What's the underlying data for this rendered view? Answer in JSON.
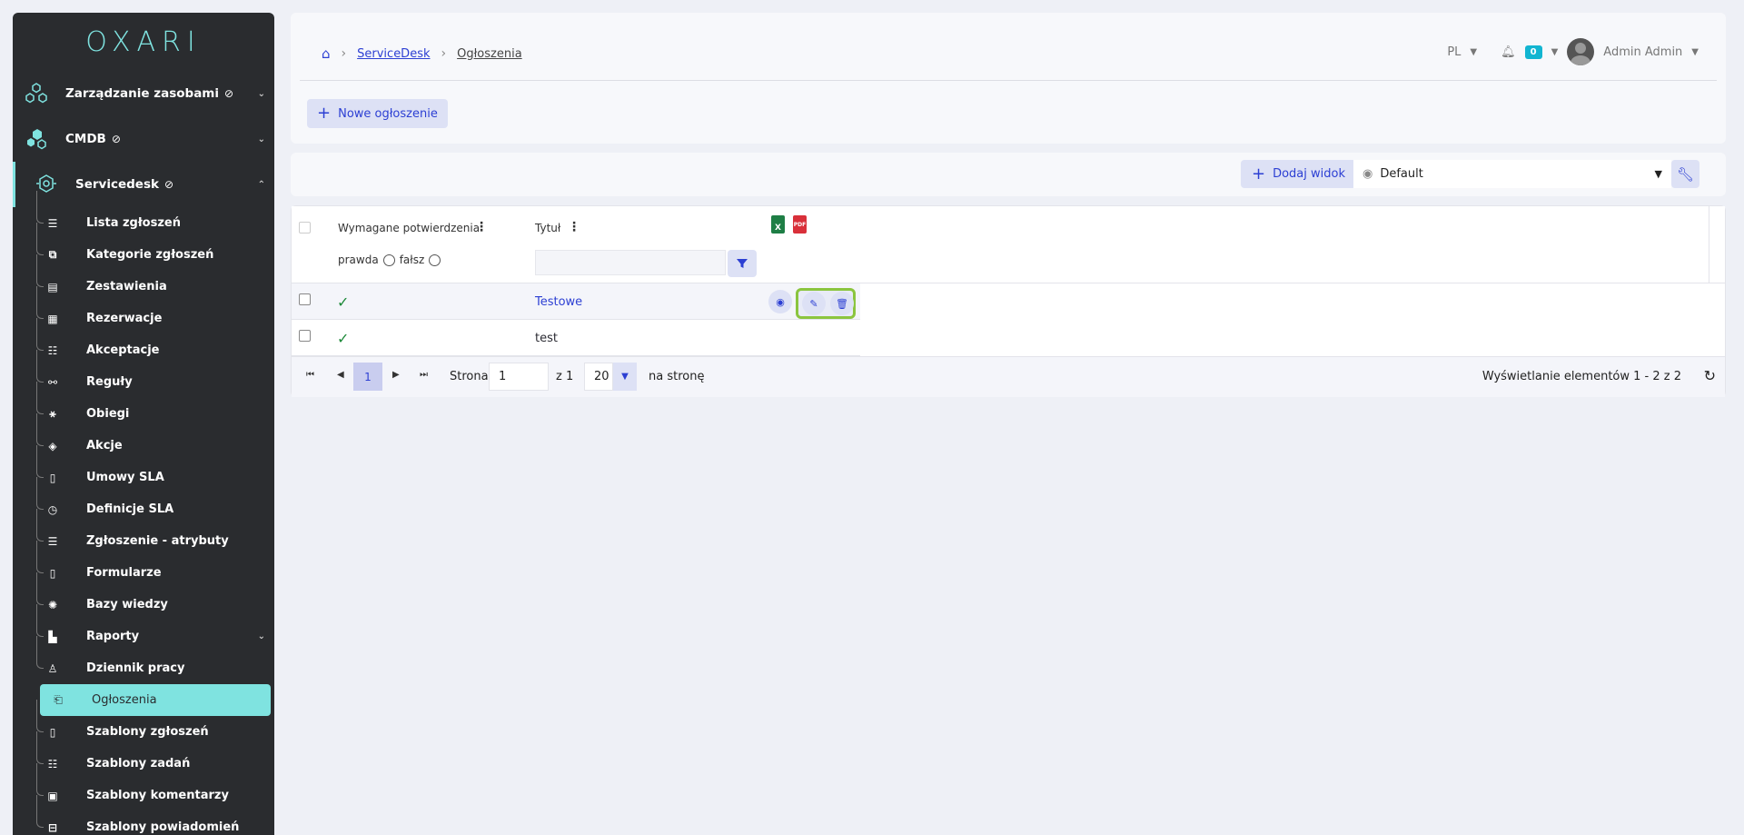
{
  "app": {
    "logo": "OXARI"
  },
  "sidebar": {
    "top_items": [
      {
        "label": "Zarządzanie zasobami",
        "badge": "⊘"
      },
      {
        "label": "CMDB",
        "badge": "⊘"
      },
      {
        "label": "Servicedesk",
        "badge": "⊘"
      }
    ],
    "sub_items": [
      {
        "label": "Lista zgłoszeń"
      },
      {
        "label": "Kategorie zgłoszeń"
      },
      {
        "label": "Zestawienia"
      },
      {
        "label": "Rezerwacje"
      },
      {
        "label": "Akceptacje"
      },
      {
        "label": "Reguły"
      },
      {
        "label": "Obiegi"
      },
      {
        "label": "Akcje"
      },
      {
        "label": "Umowy SLA"
      },
      {
        "label": "Definicje SLA"
      },
      {
        "label": "Zgłoszenie - atrybuty"
      },
      {
        "label": "Formularze"
      },
      {
        "label": "Bazy wiedzy"
      },
      {
        "label": "Raporty"
      },
      {
        "label": "Dziennik pracy"
      },
      {
        "label": "Ogłoszenia"
      },
      {
        "label": "Szablony zgłoszeń"
      },
      {
        "label": "Szablony zadań"
      },
      {
        "label": "Szablony komentarzy"
      },
      {
        "label": "Szablony powiadomień"
      }
    ]
  },
  "breadcrumb": {
    "items": [
      "ServiceDesk",
      "Ogłoszenia"
    ]
  },
  "header": {
    "lang": "PL",
    "notifications": "0",
    "user": "Admin Admin"
  },
  "toolbar": {
    "new_label": "Nowe ogłoszenie"
  },
  "view": {
    "add_label": "Dodaj widok",
    "selected": "Default"
  },
  "table": {
    "columns": [
      "Wymagane potwierdzenia",
      "Tytuł"
    ],
    "filter": {
      "true_label": "prawda",
      "false_label": "fałsz"
    },
    "export": {
      "xls": "X",
      "pdf": "PDF"
    },
    "rows": [
      {
        "confirm": "✓",
        "title": "Testowe"
      },
      {
        "confirm": "✓",
        "title": "test"
      }
    ]
  },
  "pager": {
    "current_page": "1",
    "page_label": "Strona",
    "page_value": "1",
    "of_label": "z 1",
    "per_page": "20",
    "per_page_label": "na stronę",
    "summary": "Wyświetlanie elementów 1 - 2 z 2"
  },
  "colors": {
    "accent": "#2c3fd3",
    "sidebar_bg": "#2a2c2f",
    "sidebar_active": "#7fe3e0",
    "highlight": "#8bc53f"
  }
}
